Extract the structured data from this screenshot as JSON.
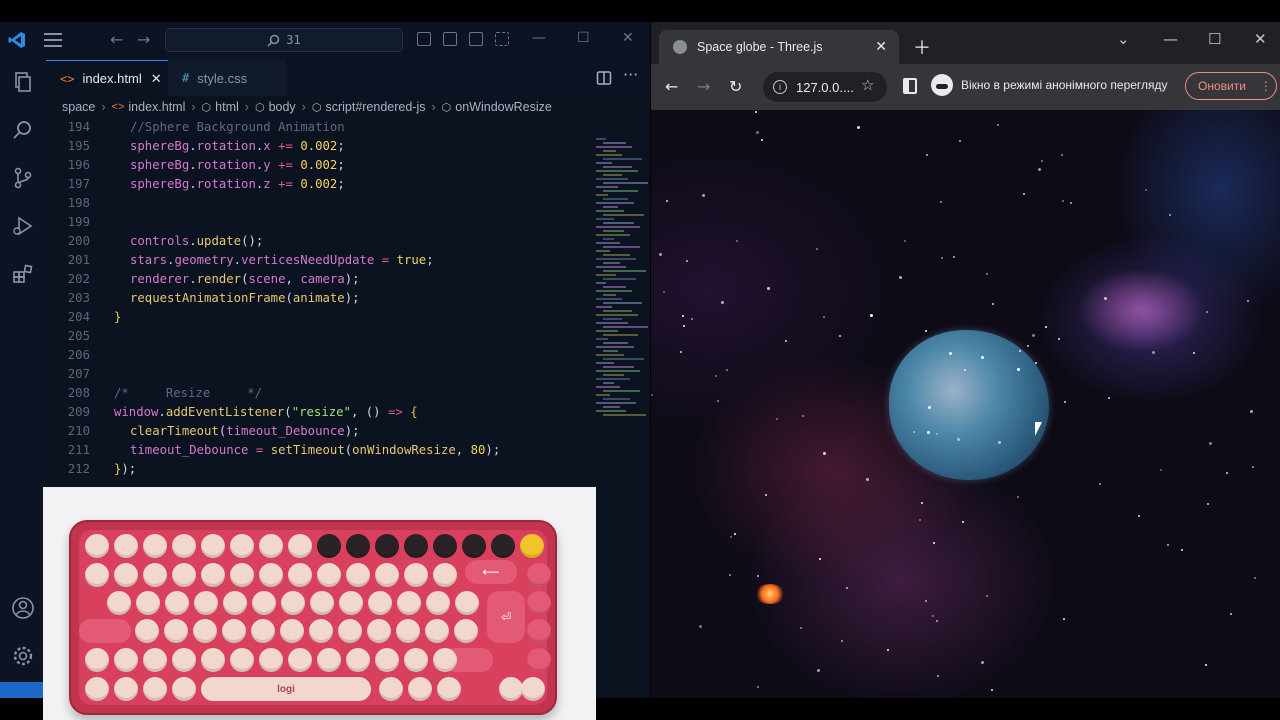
{
  "vscode": {
    "search_text": "31",
    "tabs": [
      {
        "label": "index.html",
        "icon": "<>",
        "active": true
      },
      {
        "label": "style.css",
        "icon": "#",
        "active": false
      }
    ],
    "breadcrumb": [
      "space",
      "index.html",
      "html",
      "body",
      "script#rendered-js",
      "onWindowResize"
    ],
    "code_lines": [
      {
        "n": "194",
        "html": "<span class='c-com'>//Sphere Background Animation</span>"
      },
      {
        "n": "195",
        "html": "<span class='c-var'>sphereBg</span>.<span class='c-var'>rotation</span>.<span class='c-var'>x</span> <span class='c-kw'>+=</span> <span class='c-num'>0.002</span>;"
      },
      {
        "n": "196",
        "html": "<span class='c-var'>sphereBg</span>.<span class='c-var'>rotation</span>.<span class='c-var'>y</span> <span class='c-kw'>+=</span> <span class='c-num'>0.002</span>;"
      },
      {
        "n": "197",
        "html": "<span class='c-var'>sphereBg</span>.<span class='c-var'>rotation</span>.<span class='c-var'>z</span> <span class='c-kw'>+=</span> <span class='c-num'>0.002</span>;"
      },
      {
        "n": "198",
        "html": ""
      },
      {
        "n": "199",
        "html": ""
      },
      {
        "n": "200",
        "html": "<span class='c-var'>controls</span>.<span class='c-fn'>update</span>();"
      },
      {
        "n": "201",
        "html": "<span class='c-var'>stars</span>.<span class='c-var'>geometry</span>.<span class='c-var'>verticesNeedUpdate</span> <span class='c-kw'>=</span> <span class='c-num'>true</span>;"
      },
      {
        "n": "202",
        "html": "<span class='c-var'>renderer</span>.<span class='c-fn'>render</span>(<span class='c-var'>scene</span>, <span class='c-var'>camera</span>);"
      },
      {
        "n": "203",
        "html": "<span class='c-fn'>requestAnimationFrame</span>(<span class='c-fn'>animate</span>);"
      },
      {
        "n": "204",
        "html": "<span class='c-br'>}</span>"
      },
      {
        "n": "205",
        "html": ""
      },
      {
        "n": "206",
        "html": ""
      },
      {
        "n": "207",
        "html": ""
      },
      {
        "n": "208",
        "html": "<span class='c-com'>/*     Resize     */</span>"
      },
      {
        "n": "209",
        "html": "<span class='c-var'>window</span>.<span class='c-fn'>addEventListener</span>(<span class='c-str'>\"resize\"</span>, () <span class='c-kw'>=></span> <span class='c-br'>{</span>"
      },
      {
        "n": "210",
        "html": "<span class='c-fn'>clearTimeout</span>(<span class='c-var'>timeout_Debounce</span>);"
      },
      {
        "n": "211",
        "html": "<span class='c-var'>timeout_Debounce</span> <span class='c-kw'>=</span> <span class='c-fn'>setTimeout</span>(<span class='c-fn'>onWindowResize</span>, <span class='c-num'>80</span>);"
      },
      {
        "n": "212",
        "html": "<span class='c-br'>}</span>);"
      }
    ]
  },
  "keyboard": {
    "brand": "logi",
    "delete_label": "delete"
  },
  "chrome": {
    "tab_title": "Space globe - Three.js",
    "address": "127.0.0....",
    "incognito_text": "Вікно в режимі анонімного перегляду",
    "update_label": "Оновити"
  }
}
